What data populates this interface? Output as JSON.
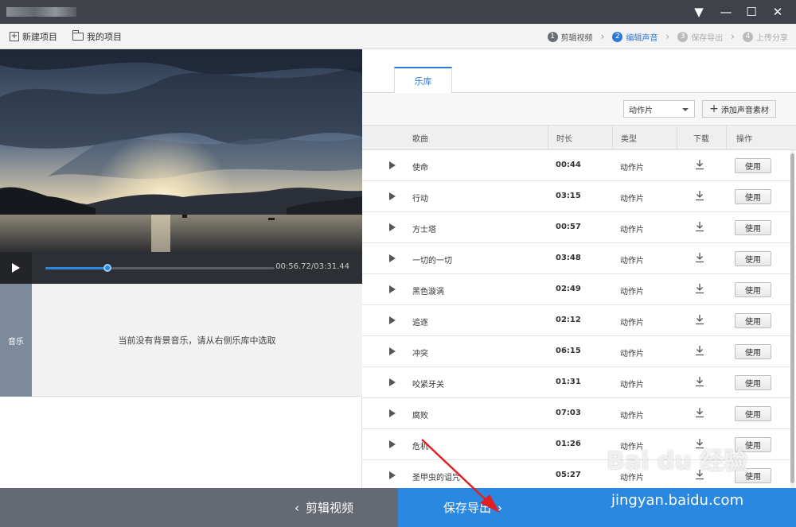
{
  "window": {
    "controls": {
      "menu": "▼",
      "minimize": "—",
      "maximize": "☐",
      "close": "✕"
    }
  },
  "toolbar": {
    "new_project": "新建项目",
    "my_projects": "我的项目",
    "steps": [
      {
        "num": "1",
        "label": "剪辑视频",
        "state": "done"
      },
      {
        "num": "2",
        "label": "编辑声音",
        "state": "active"
      },
      {
        "num": "3",
        "label": "保存导出",
        "state": "todo"
      },
      {
        "num": "4",
        "label": "上传分享",
        "state": "todo"
      }
    ]
  },
  "player": {
    "time": "00:56.72/03:31.44",
    "progress": 0.27
  },
  "music_track": {
    "label": "音乐",
    "empty_hint": "当前没有背景音乐，请从右侧乐库中选取"
  },
  "library": {
    "tab": "乐库",
    "filter_selected": "动作片",
    "add_button": "添加声音素材",
    "columns": [
      "歌曲",
      "时长",
      "类型",
      "下载",
      "操作"
    ],
    "use_label": "使用",
    "songs": [
      {
        "name": "使命",
        "duration": "00:44",
        "type": "动作片"
      },
      {
        "name": "行动",
        "duration": "03:15",
        "type": "动作片"
      },
      {
        "name": "方士塔",
        "duration": "00:57",
        "type": "动作片"
      },
      {
        "name": "一切的一切",
        "duration": "03:48",
        "type": "动作片"
      },
      {
        "name": "黑色漩涡",
        "duration": "02:49",
        "type": "动作片"
      },
      {
        "name": "追逐",
        "duration": "02:12",
        "type": "动作片"
      },
      {
        "name": "冲突",
        "duration": "06:15",
        "type": "动作片"
      },
      {
        "name": "咬紧牙关",
        "duration": "01:31",
        "type": "动作片"
      },
      {
        "name": "腐败",
        "duration": "07:03",
        "type": "动作片"
      },
      {
        "name": "危机",
        "duration": "01:26",
        "type": "动作片"
      },
      {
        "name": "圣甲虫的诅咒",
        "duration": "05:27",
        "type": "动作片"
      }
    ]
  },
  "bottom_bar": {
    "back": "剪辑视频",
    "next": "保存导出"
  },
  "watermark": {
    "logo": "Bai du 经验",
    "url": "jingyan.baidu.com"
  },
  "colors": {
    "accent": "#2b88e0",
    "titlebar": "#3f4248",
    "back_button": "#656a72"
  }
}
